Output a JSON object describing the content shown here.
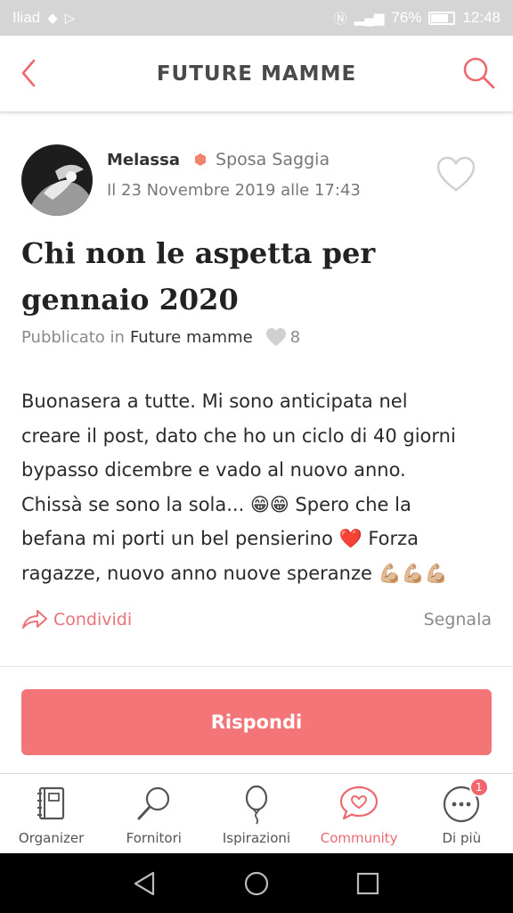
{
  "status_bar": {
    "carrier": "Iliad",
    "battery": "76%",
    "time": "12:48"
  },
  "header": {
    "title": "FUTURE MAMME"
  },
  "post": {
    "author": "Melassa",
    "rank": "Sposa Saggia",
    "date": "Il 23 Novembre 2019 alle 17:43",
    "title": "Chi non le aspetta per gennaio 2020",
    "published_label": "Pubblicato in",
    "category": "Future mamme",
    "likes": "8",
    "body_lines": [
      "Buonasera a tutte. Mi sono anticipata nel",
      "creare il post, dato che ho un ciclo di 40 giorni",
      "bypasso dicembre e vado al nuovo anno.",
      "Chissà se sono la sola... 😁😁 Spero che la",
      "befana mi porti un bel pensierino ❤️ Forza",
      "ragazze, nuovo anno nuove speranze 💪🏼💪🏼💪🏼"
    ],
    "share_label": "Condividi",
    "report_label": "Segnala"
  },
  "reply_button": "Rispondi",
  "tabs": [
    {
      "label": "Organizer",
      "icon": "planner-icon"
    },
    {
      "label": "Fornitori",
      "icon": "search-icon"
    },
    {
      "label": "Ispirazioni",
      "icon": "balloon-icon"
    },
    {
      "label": "Community",
      "icon": "chat-heart-icon",
      "active": true
    },
    {
      "label": "Di più",
      "icon": "more-icon",
      "badge": "1"
    }
  ],
  "colors": {
    "accent": "#f37578",
    "accent_text": "#e9727b",
    "rank_dot": "#f0846c"
  }
}
